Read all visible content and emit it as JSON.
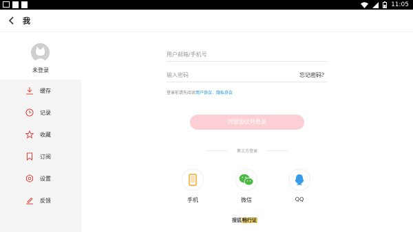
{
  "status_bar": {
    "time": "11:05"
  },
  "header": {
    "title": "我"
  },
  "profile": {
    "label": "未登录"
  },
  "menu": {
    "items": [
      {
        "label": "缓存",
        "icon": "download-icon"
      },
      {
        "label": "记录",
        "icon": "clock-icon"
      },
      {
        "label": "收藏",
        "icon": "star-icon"
      },
      {
        "label": "订阅",
        "icon": "bookmark-icon"
      },
      {
        "label": "设置",
        "icon": "gear-icon"
      },
      {
        "label": "反馈",
        "icon": "pencil-icon"
      }
    ]
  },
  "login": {
    "username_placeholder": "用户邮箱/手机号",
    "password_placeholder": "输入密码",
    "forgot_password": "忘记密码？",
    "agreement_prefix": "登录前请先阅读",
    "user_agreement": "用户协议",
    "separator": "、",
    "privacy_agreement": "隐私协议",
    "submit": "同意协议并登录"
  },
  "third_party": {
    "label": "第三方登录",
    "options": [
      {
        "label": "手机",
        "icon": "phone-icon",
        "color": "#f5a623"
      },
      {
        "label": "微信",
        "icon": "wechat-icon",
        "color": "#4cb947"
      },
      {
        "label": "QQ",
        "icon": "qq-icon",
        "color": "#3a9be8"
      }
    ]
  },
  "footer": {
    "brand": "搜狐",
    "highlight": "畅行证"
  },
  "colors": {
    "accent_pink": "#fbcfd4",
    "link_blue": "#1a8fe3",
    "menu_bg": "#f4f4f4"
  }
}
